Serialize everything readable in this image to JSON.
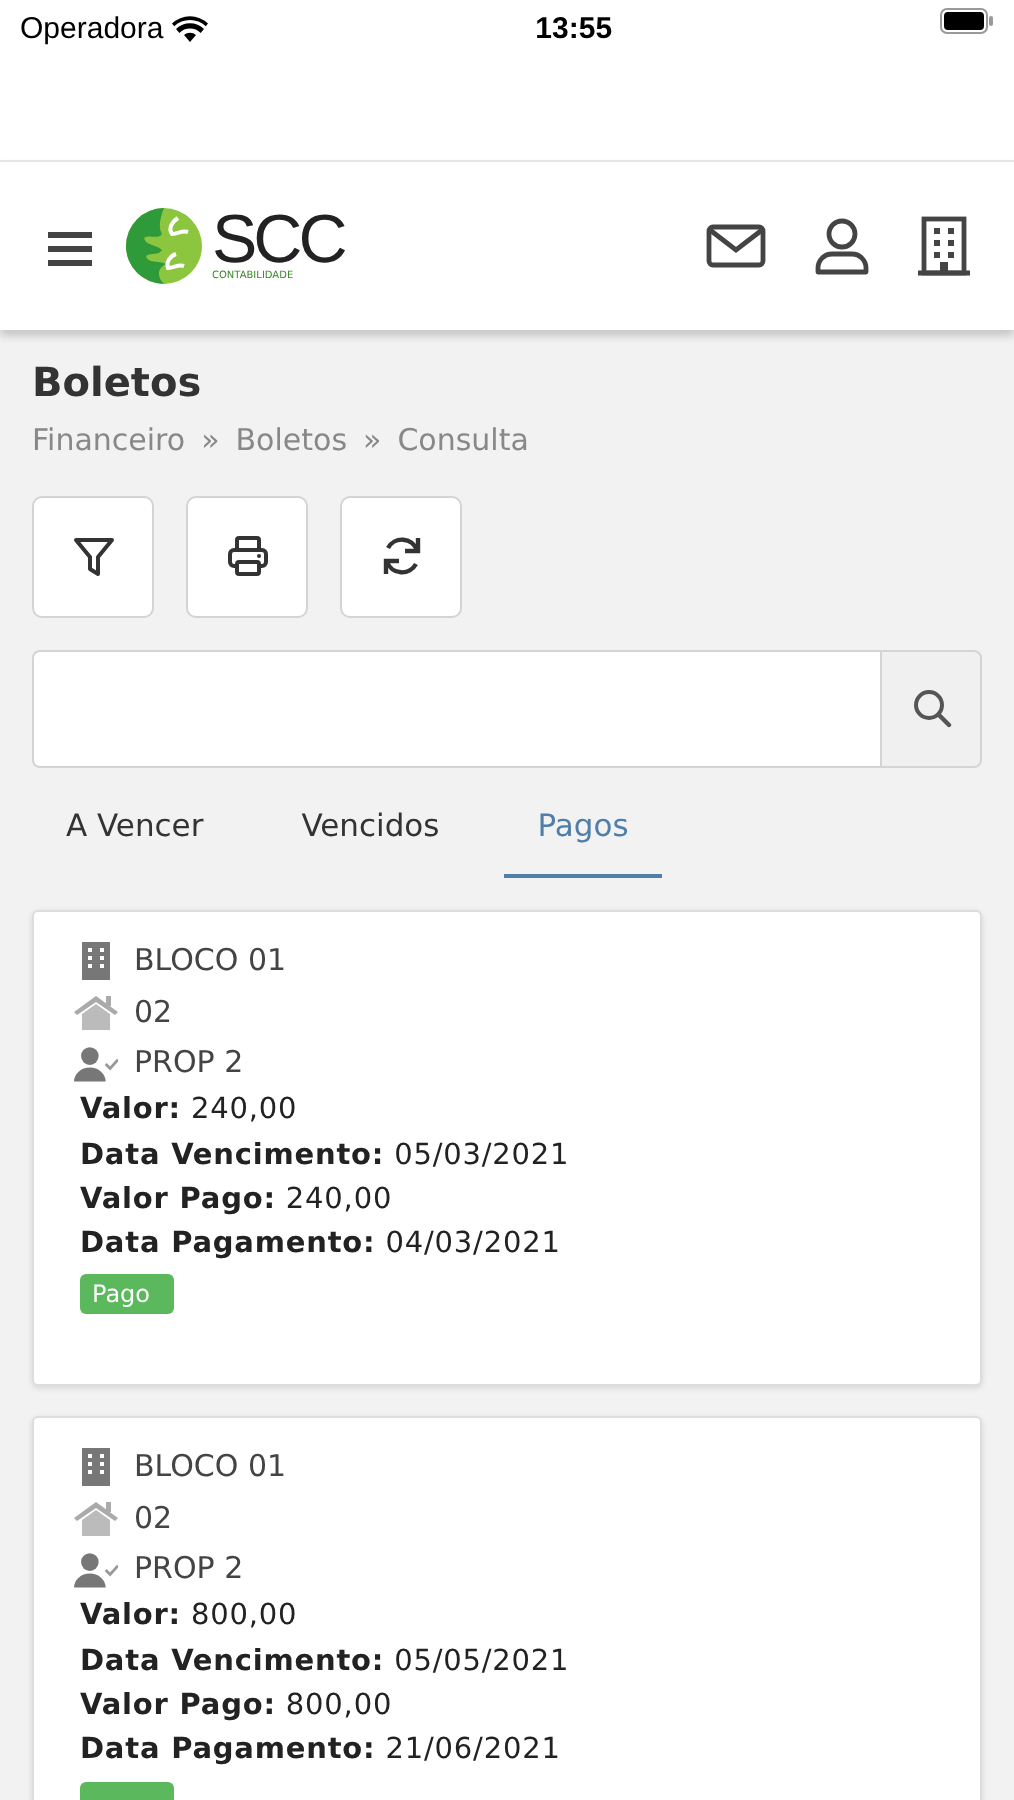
{
  "status_bar": {
    "carrier": "Operadora",
    "time": "13:55"
  },
  "header": {
    "logo_text": "SCC",
    "logo_subtext": "CONTABILIDADE"
  },
  "page": {
    "title": "Boletos",
    "breadcrumb": [
      "Financeiro",
      "Boletos",
      "Consulta"
    ],
    "breadcrumb_separator": "»"
  },
  "tabs": [
    {
      "label": "A Vencer",
      "selected": false
    },
    {
      "label": "Vencidos",
      "selected": false
    },
    {
      "label": "Pagos",
      "selected": true
    }
  ],
  "cards": [
    {
      "block": "BLOCO 01",
      "unit": "02",
      "owner": "PROP 2",
      "fields": [
        {
          "label": "Valor:",
          "value": "240,00"
        },
        {
          "label": "Data Vencimento:",
          "value": "05/03/2021"
        },
        {
          "label": "Valor Pago:",
          "value": "240,00"
        },
        {
          "label": "Data Pagamento:",
          "value": "04/03/2021"
        }
      ],
      "status": "Pago",
      "badge_visible": true
    },
    {
      "block": "BLOCO 01",
      "unit": "02",
      "owner": "PROP 2",
      "fields": [
        {
          "label": "Valor:",
          "value": "800,00"
        },
        {
          "label": "Data Vencimento:",
          "value": "05/05/2021"
        },
        {
          "label": "Valor Pago:",
          "value": "800,00"
        },
        {
          "label": "Data Pagamento:",
          "value": "21/06/2021"
        }
      ],
      "badge_visible": true
    }
  ]
}
